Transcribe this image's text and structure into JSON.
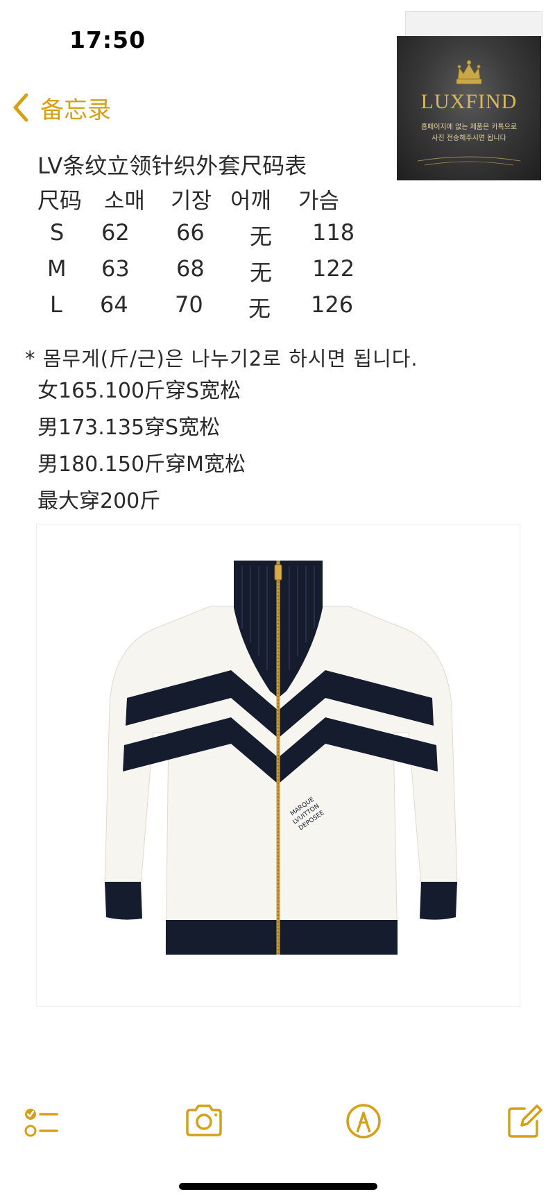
{
  "status_bar": {
    "time": "17:50"
  },
  "nav": {
    "back_label": "备忘录"
  },
  "watermark": {
    "brand": "LUXFIND",
    "line1": "홈페이지에 없는 제품은 카톡으로",
    "line2": "사진 전송해주시면 됩니다"
  },
  "note": {
    "title": "LV条纹立领针织外套尺码表",
    "table": {
      "headers": [
        "尺码",
        "소매",
        "기장",
        "어깨",
        "가슴"
      ],
      "rows": [
        [
          "S",
          "62",
          "66",
          "无",
          "118"
        ],
        [
          "M",
          "63",
          "68",
          "无",
          "122"
        ],
        [
          "L",
          "64",
          "70",
          "无",
          "126"
        ]
      ]
    },
    "weight_note": "* 몸무게(斤/근)은 나누기2로 하시면 됩니다.",
    "fit_lines": [
      "女165.100斤穿S宽松",
      "男173.135穿S宽松",
      "男180.150斤穿M宽松",
      "最大穿200斤"
    ]
  },
  "product_image": {
    "chest_print": [
      "MARQUE",
      "LVUITTON",
      "DEPOSEE"
    ]
  },
  "toolbar": {
    "icons": [
      "checklist-icon",
      "camera-icon",
      "markup-icon",
      "compose-icon"
    ]
  },
  "colors": {
    "accent": "#d4a017",
    "navy": "#141c2e",
    "zipper_gold": "#c89a3a"
  }
}
